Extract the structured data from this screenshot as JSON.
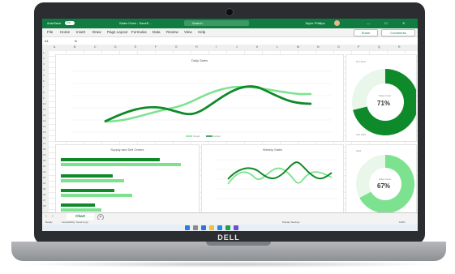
{
  "excel": {
    "autosave": "AutoSave",
    "toggle": "On",
    "filename": "Sales Chart - SaveE...",
    "search_placeholder": "Search",
    "user": "Taylor Phillips",
    "menu": [
      "File",
      "Home",
      "Insert",
      "Draw",
      "Page Layout",
      "Formulas",
      "Data",
      "Review",
      "View",
      "Help"
    ],
    "share": "Share",
    "comments": "Comments",
    "namebox": "A1",
    "fx": "fx",
    "columns": [
      "A",
      "B",
      "C",
      "D",
      "E",
      "F",
      "G",
      "H",
      "I",
      "J",
      "K",
      "L",
      "M",
      "N",
      "O",
      "P",
      "Q",
      "R"
    ],
    "rows": [
      "1",
      "2",
      "3",
      "4",
      "5",
      "6",
      "7",
      "8",
      "9",
      "10",
      "11",
      "12",
      "13",
      "14",
      "15",
      "16",
      "17",
      "18",
      "19",
      "20",
      "21",
      "22",
      "23",
      "24",
      "25",
      "26",
      "27",
      "28"
    ],
    "sheet_tab": "Chart",
    "status_left": "Ready",
    "status_access": "Accessibility: Good to go",
    "display_settings": "Display Settings",
    "zoom": "100%"
  },
  "charts": {
    "daily_title": "Daily Sales",
    "daily_legend": [
      "Target",
      "Actual"
    ],
    "supply_title": "Supply and Sell Orders",
    "weekly_title": "Weekly Sales",
    "donut1_value": "71%",
    "donut1_center": "Sales Goal",
    "donut1_top": "Net Sold",
    "donut1_bottom": "Left Sold",
    "donut2_value": "67%",
    "donut2_center": "Sales Goal",
    "donut2_top": "Sold",
    "colors": {
      "dark": "#0f8a2a",
      "light": "#7de28f",
      "excel": "#107c41"
    }
  },
  "brand": {
    "logo": "DELL"
  }
}
